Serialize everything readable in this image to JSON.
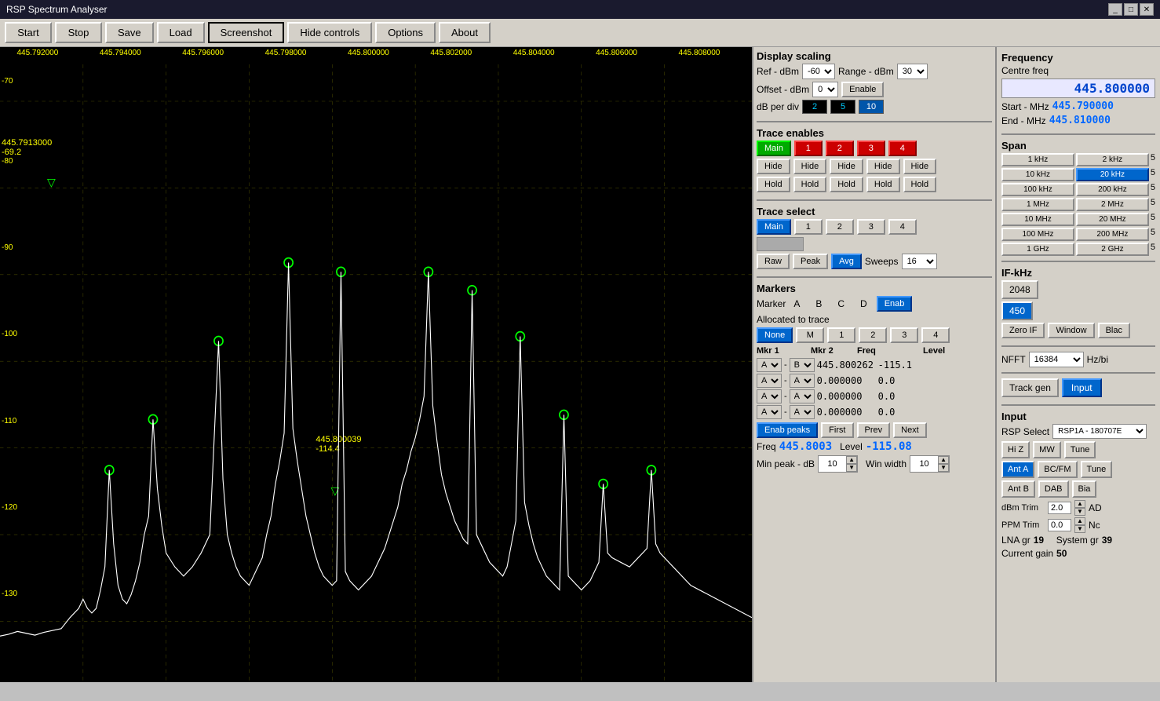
{
  "window": {
    "title": "RSP Spectrum Analyser",
    "controls": [
      "_",
      "□",
      "✕"
    ]
  },
  "toolbar": {
    "buttons": [
      {
        "label": "Start",
        "name": "start-button",
        "active": false
      },
      {
        "label": "Stop",
        "name": "stop-button",
        "active": false
      },
      {
        "label": "Save",
        "name": "save-button",
        "active": false
      },
      {
        "label": "Load",
        "name": "load-button",
        "active": false
      },
      {
        "label": "Screenshot",
        "name": "screenshot-button",
        "active": true
      },
      {
        "label": "Hide controls",
        "name": "hide-controls-button",
        "active": false
      },
      {
        "label": "Options",
        "name": "options-button",
        "active": false
      },
      {
        "label": "About",
        "name": "about-button",
        "active": false
      }
    ]
  },
  "spectrum": {
    "freq_labels": [
      "445.792000",
      "445.794000",
      "445.796000",
      "445.798000",
      "445.800000",
      "445.802000",
      "445.804000",
      "445.806000",
      "445.808000"
    ],
    "db_labels": [
      "-70",
      "-80",
      "-90",
      "-100",
      "-110",
      "-120",
      "-130"
    ],
    "marker1": {
      "freq": "445.7913000",
      "level": "-69.2"
    },
    "marker2": {
      "freq": "445.800039",
      "level": "-114.4"
    }
  },
  "display_scaling": {
    "title": "Display scaling",
    "ref_dbm_label": "Ref - dBm",
    "ref_dbm_value": "-60",
    "range_dbm_label": "Range - dBm",
    "range_dbm_value": "30",
    "offset_dbm_label": "Offset - dBm",
    "offset_dbm_value": "0",
    "enable_label": "Enable",
    "db_per_div_label": "dB per div",
    "db_options": [
      "2",
      "5",
      "10"
    ],
    "db_selected": "10"
  },
  "trace_enables": {
    "title": "Trace enables",
    "main_label": "Main",
    "traces": [
      "1",
      "2",
      "3",
      "4"
    ],
    "hide_labels": [
      "Hide",
      "Hide",
      "Hide",
      "Hide",
      "Hide"
    ],
    "hold_labels": [
      "Hold",
      "Hold",
      "Hold",
      "Hold",
      "Hold"
    ]
  },
  "trace_select": {
    "title": "Trace select",
    "options": [
      "Main",
      "1",
      "2",
      "3",
      "4"
    ],
    "raw_label": "Raw",
    "peak_label": "Peak",
    "avg_label": "Avg",
    "sweeps_label": "Sweeps",
    "sweeps_value": "16"
  },
  "markers": {
    "title": "Markers",
    "marker_label": "Marker",
    "labels": [
      "A",
      "B",
      "C",
      "D"
    ],
    "enab_label": "Enab",
    "allocated_label": "Allocated to trace",
    "alloc_options": [
      "None",
      "M",
      "1",
      "2",
      "3",
      "4"
    ],
    "mkr1_label": "Mkr 1",
    "mkr2_label": "Mkr 2",
    "freq_label": "Freq",
    "level_label": "Level",
    "rows": [
      {
        "mkr1": "A",
        "dash": "-",
        "mkr2": "B",
        "freq": "445.800262",
        "level": "-115.1"
      },
      {
        "mkr1": "A",
        "dash": "-",
        "mkr2": "A",
        "freq": "0.000000",
        "level": "0.0"
      },
      {
        "mkr1": "A",
        "dash": "-",
        "mkr2": "A",
        "freq": "0.000000",
        "level": "0.0"
      },
      {
        "mkr1": "A",
        "dash": "-",
        "mkr2": "A",
        "freq": "0.000000",
        "level": "0.0"
      }
    ],
    "enab_peaks_label": "Enab peaks",
    "first_label": "First",
    "prev_label": "Prev",
    "next_label": "Next",
    "freq_val": "445.8003",
    "level_val": "-115.08",
    "min_peak_label": "Min peak - dB",
    "min_peak_value": "10",
    "win_width_label": "Win width",
    "win_width_value": "10"
  },
  "frequency": {
    "title": "Frequency",
    "centre_freq_label": "Centre freq",
    "centre_freq_value": "445.800000",
    "start_mhz_label": "Start - MHz",
    "start_mhz_value": "445.790000",
    "end_mhz_label": "End - MHz",
    "end_mhz_value": "445.810000"
  },
  "span": {
    "title": "Span",
    "buttons": [
      [
        "1 kHz",
        "2 kHz",
        "5"
      ],
      [
        "10 kHz",
        "20 kHz",
        "5"
      ],
      [
        "100 kHz",
        "200 kHz",
        "5"
      ],
      [
        "1 MHz",
        "2 MHz",
        "5"
      ],
      [
        "10 MHz",
        "20 MHz",
        "5"
      ],
      [
        "100 MHz",
        "200 MHz",
        "5"
      ],
      [
        "1 GHz",
        "2 GHz",
        "5"
      ]
    ],
    "active": "20 kHz"
  },
  "if_khz": {
    "title": "IF-kHz",
    "value1": "2048",
    "value2": "450",
    "active": "450",
    "zero_if_label": "Zero IF",
    "window_label": "Window",
    "blac_label": "Blac"
  },
  "nfft": {
    "label": "NFFT",
    "value": "16384",
    "hz_bit_label": "Hz/bi"
  },
  "bottom_btns": {
    "track_gen_label": "Track gen",
    "input_label": "Input"
  },
  "input_section": {
    "title": "Input",
    "rsp_select_label": "RSP Select",
    "rsp_select_value": "RSP1A - 180707E",
    "hi_z_label": "Hi Z",
    "mw_label": "MW",
    "tune_label": "Tune",
    "ant_a_label": "Ant A",
    "bc_fm_label": "BC/FM",
    "tune2_label": "Tune",
    "ant_b_label": "Ant B",
    "dab_label": "DAB",
    "bia_label": "Bia",
    "dbm_trim_label": "dBm Trim",
    "dbm_trim_value": "2.0",
    "ad_label": "AD",
    "ppm_trim_label": "PPM Trim",
    "ppm_trim_value": "0.0",
    "nc_label": "Nc",
    "lna_gr_label": "LNA gr",
    "lna_gr_value": "19",
    "system_gr_label": "System gr",
    "system_gr_value": "39",
    "current_gain_label": "Current gain",
    "current_gain_value": "50"
  }
}
